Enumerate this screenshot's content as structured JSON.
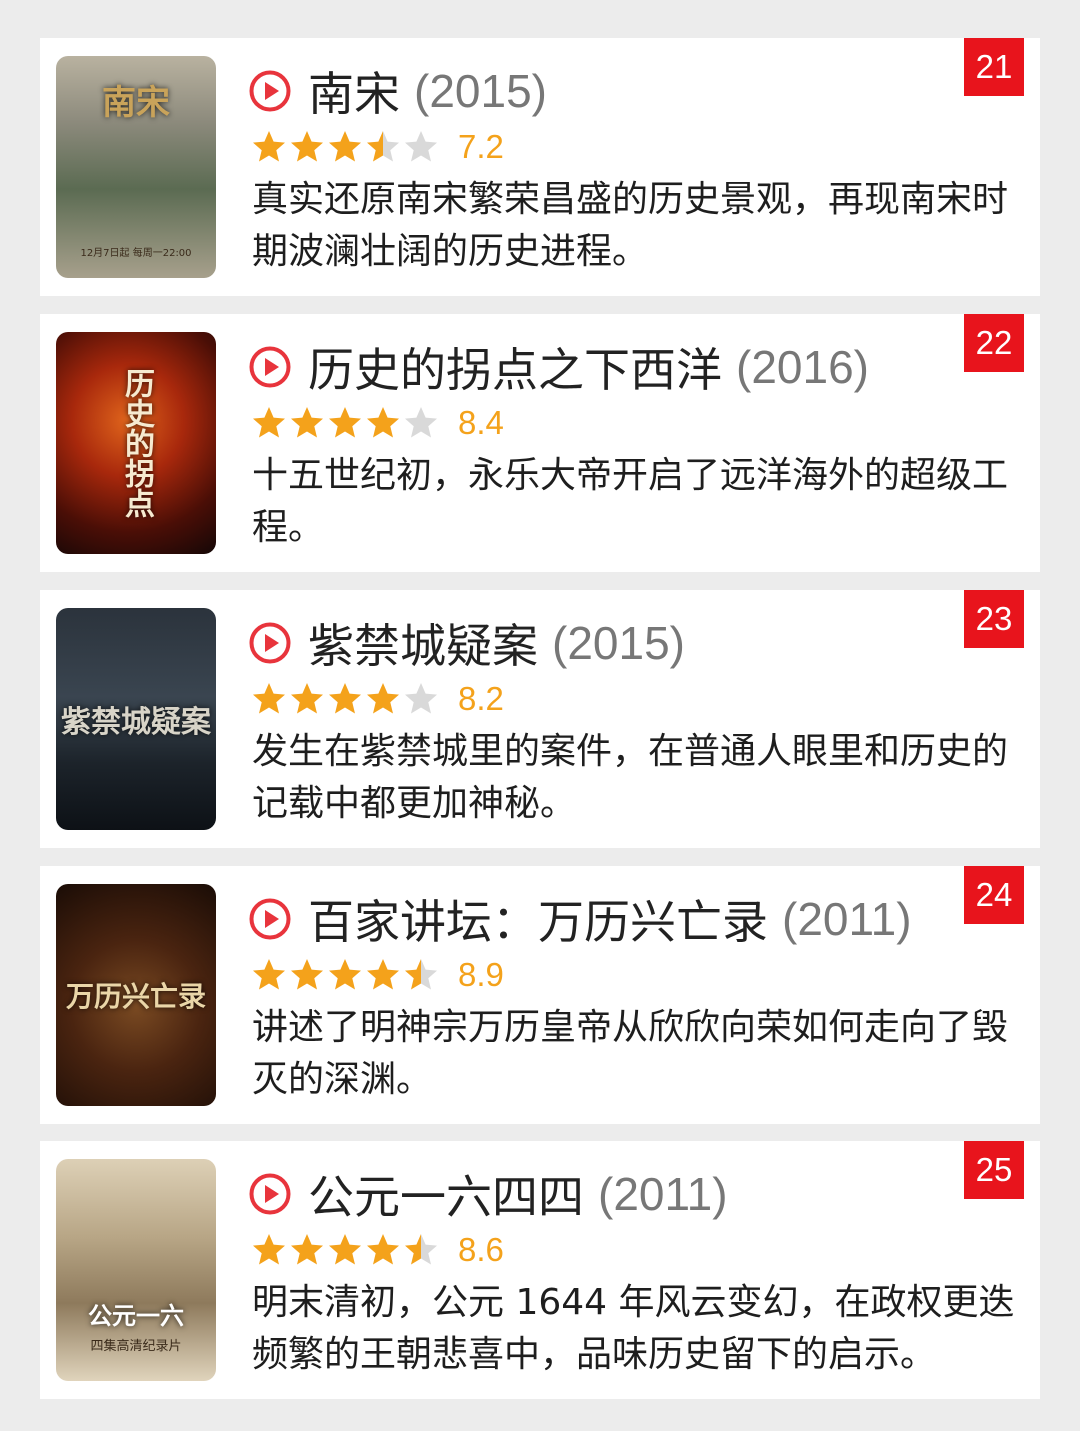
{
  "items": [
    {
      "rank": "21",
      "title": "南宋",
      "year": "(2015)",
      "rating": 3.5,
      "score": "7.2",
      "desc": "真实还原南宋繁荣昌盛的历史景观，再现南宋时期波澜壮阔的历史进程。",
      "poster_text": "南宋",
      "poster_subtext": "12月7日起 每周一22:00",
      "poster_colors": [
        "#8c8a7c",
        "#5b6b52",
        "#a7a08c"
      ]
    },
    {
      "rank": "22",
      "title": "历史的拐点之下西洋",
      "year": "(2016)",
      "rating": 4,
      "score": "8.4",
      "desc": "十五世纪初，永乐大帝开启了远洋海外的超级工程。",
      "poster_text": "历史的拐点",
      "poster_colors": [
        "#7a1408",
        "#c2410f",
        "#1a0a06"
      ]
    },
    {
      "rank": "23",
      "title": "紫禁城疑案",
      "year": "(2015)",
      "rating": 4,
      "score": "8.2",
      "desc": "发生在紫禁城里的案件，在普通人眼里和历史的记载中都更加神秘。",
      "poster_text": "紫禁城疑案",
      "poster_colors": [
        "#1d242c",
        "#3a4550",
        "#0d1116"
      ]
    },
    {
      "rank": "24",
      "title": "百家讲坛：万历兴亡录",
      "year": "(2011)",
      "rating": 4.5,
      "score": "8.9",
      "desc": "讲述了明神宗万历皇帝从欣欣向荣如何走向了毁灭的深渊。",
      "poster_text": "万历兴亡录",
      "poster_colors": [
        "#3a1a0e",
        "#6b3a1c",
        "#1a0c06"
      ]
    },
    {
      "rank": "25",
      "title": "公元一六四四",
      "year": "(2011)",
      "rating": 4.5,
      "score": "8.6",
      "desc": "明末清初，公元 1644 年风云变幻，在政权更迭频繁的王朝悲喜中，品味历史留下的启示。",
      "poster_text": "公元一六",
      "poster_subtext": "四集高清纪录片",
      "poster_colors": [
        "#c9b89a",
        "#8e7a5c",
        "#e0d4bc"
      ]
    }
  ],
  "colors": {
    "rank_bg": "#e8141c",
    "star_on": "#f4a21b",
    "star_off": "#d9d9d9",
    "play_icon": "#e8343c"
  },
  "icons": {
    "play": "play-circle-icon",
    "star": "star-icon"
  }
}
